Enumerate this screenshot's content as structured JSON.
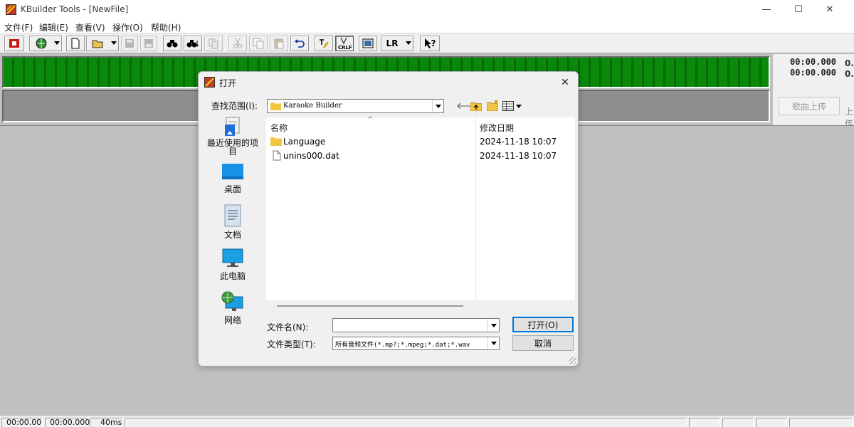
{
  "window": {
    "title": "KBuilder Tools - [NewFile]",
    "minimize": "—",
    "maximize": "☐",
    "close": "✕"
  },
  "menu": {
    "items": [
      {
        "label": "文件(F)"
      },
      {
        "label": "编辑(E)"
      },
      {
        "label": "查看(V)"
      },
      {
        "label": "操作(O)"
      },
      {
        "label": "帮助(H)"
      }
    ]
  },
  "toolbar": {
    "lr_label": "LR",
    "help_label": "?"
  },
  "right_panel": {
    "time1": "00:00.000",
    "time2": "00:00.000",
    "upload_label": "歌曲上传",
    "edge_1": "0.",
    "edge_2": "0.",
    "edge_3": "上传"
  },
  "status": {
    "time_start": "00:00.00",
    "time_end": "00:00.000",
    "interval": "40ms"
  },
  "dialog": {
    "title": "打开",
    "lookin_label": "查找范围(I):",
    "lookin_value": "Karaoke Builder",
    "places": [
      {
        "label": "最近使用的项目",
        "icon": "recent-icon"
      },
      {
        "label": "桌面",
        "icon": "desktop-icon"
      },
      {
        "label": "文档",
        "icon": "documents-icon"
      },
      {
        "label": "此电脑",
        "icon": "computer-icon"
      },
      {
        "label": "网络",
        "icon": "network-icon"
      }
    ],
    "columns": {
      "name": "名称",
      "date": "修改日期"
    },
    "files": [
      {
        "name": "Language",
        "date": "2024-11-18 10:07",
        "icon": "folder-icon"
      },
      {
        "name": "unins000.dat",
        "date": "2024-11-18 10:07",
        "icon": "file-icon"
      }
    ],
    "filename_label": "文件名(N):",
    "filename_value": "",
    "filetype_label": "文件类型(T):",
    "filetype_value": "所有音频文件(*.mp?;*.mpeg;*.dat;*.wav",
    "open_button": "打开(O)",
    "cancel_button": "取消"
  },
  "colors": {
    "wave_green": "#0a8a0a",
    "workspace_gray": "#c0c0c0",
    "panel_gray": "#8f8f8f",
    "accent_blue": "#0078d7"
  }
}
